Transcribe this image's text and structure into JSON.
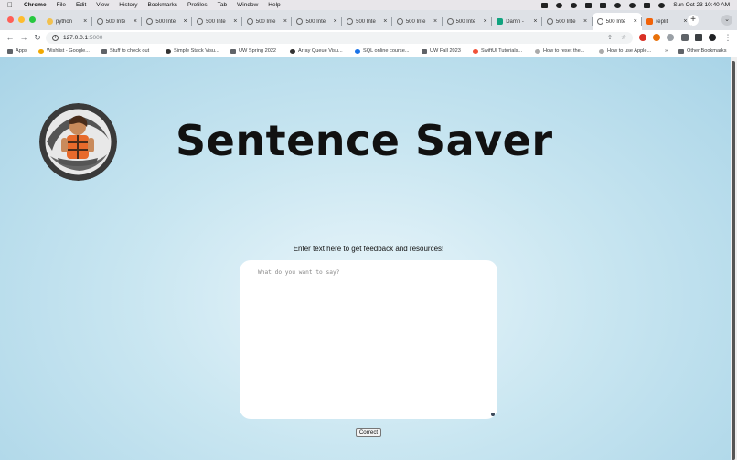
{
  "menubar": {
    "app": "Chrome",
    "items": [
      "File",
      "Edit",
      "View",
      "History",
      "Bookmarks",
      "Profiles",
      "Tab",
      "Window",
      "Help"
    ],
    "datetime": "Sun Oct 23  10:40 AM"
  },
  "tabs": [
    {
      "label": "python",
      "icon": "python-icon",
      "active": false
    },
    {
      "label": "500 Inte",
      "icon": "globe-icon",
      "active": false
    },
    {
      "label": "500 Inte",
      "icon": "globe-icon",
      "active": false
    },
    {
      "label": "500 Inte",
      "icon": "globe-icon",
      "active": false
    },
    {
      "label": "500 Inte",
      "icon": "globe-icon",
      "active": false
    },
    {
      "label": "500 Inte",
      "icon": "globe-icon",
      "active": false
    },
    {
      "label": "500 Inte",
      "icon": "globe-icon",
      "active": false
    },
    {
      "label": "500 Inte",
      "icon": "globe-icon",
      "active": false
    },
    {
      "label": "500 Inte",
      "icon": "globe-icon",
      "active": false
    },
    {
      "label": "Damn -",
      "icon": "chatgpt-icon",
      "active": false
    },
    {
      "label": "500 Inte",
      "icon": "globe-icon",
      "active": false
    },
    {
      "label": "500 Inte",
      "icon": "globe-icon",
      "active": true
    },
    {
      "label": "replit",
      "icon": "replit-icon",
      "active": false
    }
  ],
  "omnibox": {
    "host": "127.0.0.1",
    "port": ":5000"
  },
  "bookmarks": [
    "Apps",
    "Wishlist - Google...",
    "Stuff to check out",
    "Simple Stack Visu...",
    "UW Spring 2022",
    "Array Queue Visu...",
    "SQL online course...",
    "UW Fall 2023",
    "SwiftUI Tutorials...",
    "How to reset the...",
    "How to use Apple...",
    "»",
    "Other Bookmarks"
  ],
  "page": {
    "title": "Sentence Saver",
    "prompt": "Enter text here to get feedback and resources!",
    "textarea_placeholder": "What do you want to say?",
    "button_label": "Correct"
  }
}
